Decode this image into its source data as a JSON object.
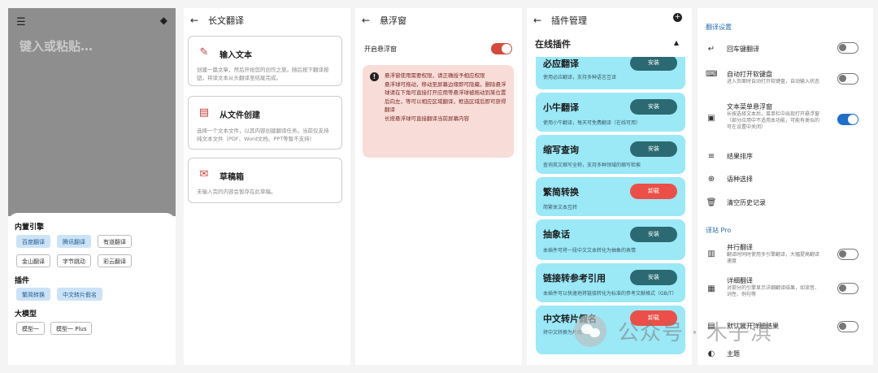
{
  "panel1": {
    "placeholder": "键入或粘贴…",
    "sections": [
      {
        "title": "内置引擎",
        "chips": [
          "百度翻译",
          "腾讯翻译",
          "有道翻译",
          "金山翻译",
          "字节跳动",
          "彩云翻译"
        ],
        "selected": [
          0,
          1
        ]
      },
      {
        "title": "插件",
        "chips": [
          "繁简转换",
          "中文转片假名"
        ],
        "selected": [
          0,
          1
        ]
      },
      {
        "title": "大模型",
        "chips": [
          "模型一",
          "模型一 Plus"
        ],
        "selected": []
      }
    ]
  },
  "panel2": {
    "title": "长文翻译",
    "cards": [
      {
        "icon": "pencil-icon",
        "title": "输入文本",
        "desc": "创建一篇文章，然后开始您的创作之旅。随后按下翻译按钮，将译文本从头翻译至结尾完成。"
      },
      {
        "icon": "file-plus-icon",
        "title": "从文件创建",
        "desc": "选择一个文本文件，以其内容创建翻译任务。当前仅支持纯文本文件（PDF、Word文档、PPT等暂不支持）"
      },
      {
        "icon": "mail-icon",
        "title": "草稿箱",
        "desc": "未输入完的内容会暂存在此草稿。"
      }
    ]
  },
  "panel3": {
    "title": "悬浮窗",
    "toggle_label": "开启悬浮窗",
    "warning_lines": [
      "悬浮窗使用需要权限，请正确授予相应权限",
      "悬浮球可拖动，移动至屏幕边缘即可隐藏。删除悬浮球请在下角可直接打开应用等悬浮球被拖动到某位置后向左，等可以相应区域翻译，框选区域后即可获得翻译",
      "长按悬浮球可直接翻译当前屏幕内容"
    ]
  },
  "panel4": {
    "title": "插件管理",
    "section": "在线插件",
    "plugins": [
      {
        "name": "必应翻译",
        "desc": "使用必应翻译，支持多种语言互译",
        "button": "安装",
        "state": "install"
      },
      {
        "name": "小牛翻译",
        "desc": "使用小牛翻译，每天可免费翻译（在线可用）",
        "button": "安装",
        "state": "install"
      },
      {
        "name": "缩写查询",
        "desc": "查询英文缩写全称，支持多种领域的缩写检索",
        "button": "安装",
        "state": "install"
      },
      {
        "name": "繁简转换",
        "desc": "简繁体文本互转",
        "button": "卸载",
        "state": "uninstall"
      },
      {
        "name": "抽象话",
        "desc": "本插件可将一段中文文本转化为抽象的表情",
        "button": "安装",
        "state": "install"
      },
      {
        "name": "链接转参考引用",
        "desc": "本插件可以快速地将链接转化为标准的参考文献格式（GB/T）",
        "button": "安装",
        "state": "install"
      },
      {
        "name": "中文转片假名",
        "desc": "将中文转换为片假名",
        "button": "卸载",
        "state": "uninstall"
      }
    ]
  },
  "panel5": {
    "section1": "翻译设置",
    "rows1": [
      {
        "icon": "enter-icon",
        "title": "回车键翻译",
        "desc": "",
        "toggle": "off"
      },
      {
        "icon": "keyboard-icon",
        "title": "自动打开软键盘",
        "desc": "进入页面时自动打开软键盘，自动输入状态",
        "toggle": "off"
      },
      {
        "icon": "clipboard-icon",
        "title": "文本菜单悬浮窗",
        "desc": "长按选择文本后，菜单栏中出现打开悬浮窗（部分应用中不适用本功能，可能有类似的可在设置中关闭）",
        "toggle": "on"
      },
      {
        "icon": "sort-icon",
        "title": "结果排序",
        "desc": "",
        "toggle": null
      },
      {
        "icon": "globe-icon",
        "title": "语种选择",
        "desc": "",
        "toggle": null
      },
      {
        "icon": "trash-icon",
        "title": "清空历史记录",
        "desc": "",
        "toggle": null
      }
    ],
    "section2": "译站 Pro",
    "rows2": [
      {
        "icon": "columns-icon",
        "title": "并行翻译",
        "desc": "翻译时同时使用多引擎翻译，大幅提高翻译速度",
        "toggle": "off"
      },
      {
        "icon": "detail-icon",
        "title": "详细翻译",
        "desc": "对部分的引擎显示详细翻译结果，如读音、词性、例句等",
        "toggle": "off"
      },
      {
        "icon": "layers-icon",
        "title": "默认展开详细结果",
        "desc": "",
        "toggle": "off"
      },
      {
        "icon": "palette-icon",
        "title": "主题",
        "desc": "",
        "toggle": null
      }
    ]
  },
  "watermark": "公众号 · 木子淇"
}
